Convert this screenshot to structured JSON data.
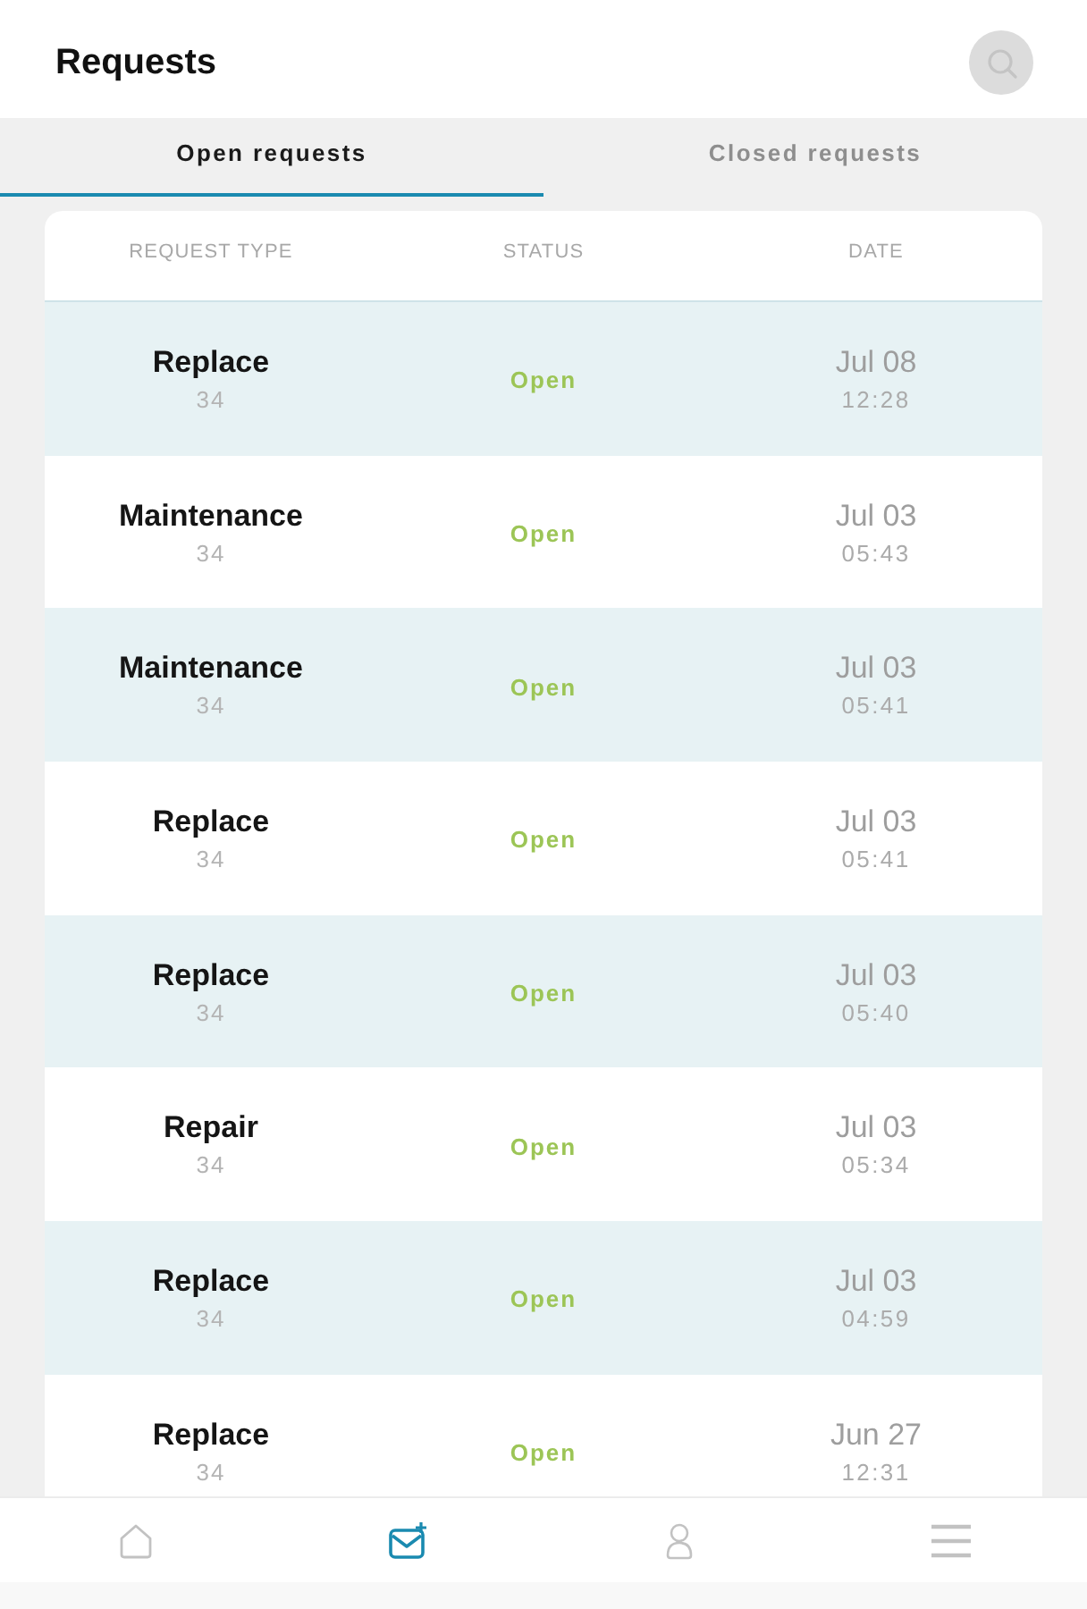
{
  "header": {
    "title": "Requests"
  },
  "tabs": [
    {
      "label": "Open requests",
      "selected": true
    },
    {
      "label": "Closed requests",
      "selected": false
    }
  ],
  "table": {
    "columns": [
      "REQUEST TYPE",
      "STATUS",
      "DATE"
    ],
    "rows": [
      {
        "type": "Replace",
        "number": "34",
        "status": "Open",
        "date": "Jul 08",
        "time": "12:28"
      },
      {
        "type": "Maintenance",
        "number": "34",
        "status": "Open",
        "date": "Jul 03",
        "time": "05:43"
      },
      {
        "type": "Maintenance",
        "number": "34",
        "status": "Open",
        "date": "Jul 03",
        "time": "05:41"
      },
      {
        "type": "Replace",
        "number": "34",
        "status": "Open",
        "date": "Jul 03",
        "time": "05:41"
      },
      {
        "type": "Replace",
        "number": "34",
        "status": "Open",
        "date": "Jul 03",
        "time": "05:40"
      },
      {
        "type": "Repair",
        "number": "34",
        "status": "Open",
        "date": "Jul 03",
        "time": "05:34"
      },
      {
        "type": "Replace",
        "number": "34",
        "status": "Open",
        "date": "Jul 03",
        "time": "04:59"
      },
      {
        "type": "Replace",
        "number": "34",
        "status": "Open",
        "date": "Jun 27",
        "time": "12:31"
      }
    ]
  },
  "bottom_nav": [
    {
      "selected": false
    },
    {
      "selected": true
    },
    {
      "selected": false
    },
    {
      "selected": false
    }
  ]
}
